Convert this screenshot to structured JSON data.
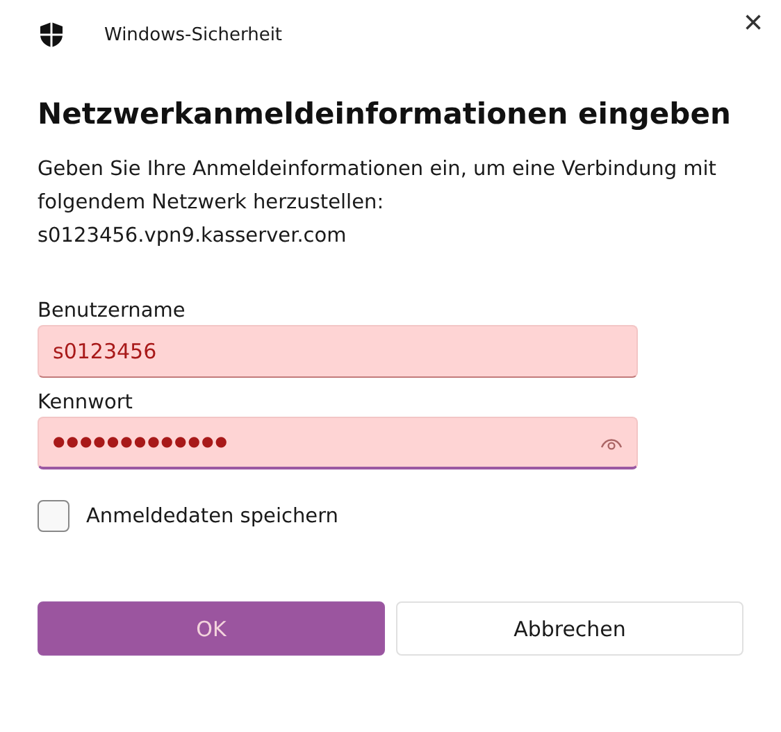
{
  "window": {
    "title": "Windows-Sicherheit",
    "close": "×"
  },
  "heading": "Netzwerkanmeldeinformationen eingeben",
  "description": [
    "Geben Sie Ihre Anmeldeinformationen ein, um eine Verbindung mit folgendem Netzwerk herzustellen:",
    "s0123456.vpn9.kasserver.com"
  ],
  "fields": [
    {
      "label": "Benutzername",
      "value": "s0123456",
      "kind": "text",
      "focused": false
    },
    {
      "label": "Kennwort",
      "value": "●●●●●●●●●●●●●",
      "kind": "password",
      "focused": true
    }
  ],
  "remember": {
    "label": "Anmeldedaten speichern",
    "checked": false
  },
  "buttons": [
    {
      "label": "OK",
      "kind": "primary"
    },
    {
      "label": "Abbrechen",
      "kind": "secondary"
    }
  ]
}
